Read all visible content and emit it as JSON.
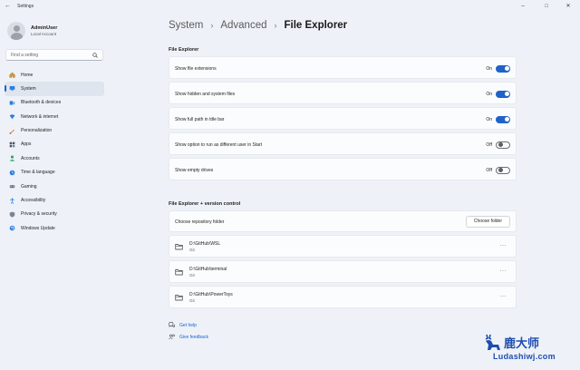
{
  "window": {
    "title": "Settings",
    "back_icon": "back-arrow-icon",
    "controls": {
      "minimize": "–",
      "maximize": "□",
      "close": "✕"
    }
  },
  "profile": {
    "name": "AdminUser",
    "account_type": "Local Account"
  },
  "search": {
    "placeholder": "Find a setting"
  },
  "nav": [
    {
      "label": "Home",
      "icon": "home-icon"
    },
    {
      "label": "System",
      "icon": "system-icon",
      "active": true
    },
    {
      "label": "Bluetooth & devices",
      "icon": "bluetooth-icon"
    },
    {
      "label": "Network & internet",
      "icon": "network-icon"
    },
    {
      "label": "Personalization",
      "icon": "personalization-icon"
    },
    {
      "label": "Apps",
      "icon": "apps-icon"
    },
    {
      "label": "Accounts",
      "icon": "accounts-icon"
    },
    {
      "label": "Time & language",
      "icon": "time-language-icon"
    },
    {
      "label": "Gaming",
      "icon": "gaming-icon"
    },
    {
      "label": "Accessibility",
      "icon": "accessibility-icon"
    },
    {
      "label": "Privacy & security",
      "icon": "privacy-icon"
    },
    {
      "label": "Windows Update",
      "icon": "windows-update-icon"
    }
  ],
  "breadcrumb": {
    "items": [
      "System",
      "Advanced"
    ],
    "current": "File Explorer",
    "separator": "›"
  },
  "file_explorer": {
    "title": "File Explorer",
    "settings": [
      {
        "label": "Show file extensions",
        "state": "On",
        "on": true
      },
      {
        "label": "Show hidden and system files",
        "state": "On",
        "on": true
      },
      {
        "label": "Show full path in title bar",
        "state": "On",
        "on": true
      },
      {
        "label": "Show option to run as different user in Start",
        "state": "Off",
        "on": false
      },
      {
        "label": "Show empty drives",
        "state": "Off",
        "on": false
      }
    ]
  },
  "version_control": {
    "title": "File Explorer + version control",
    "choose_label": "Choose repository folder",
    "choose_button": "Choose folder",
    "repos": [
      {
        "path": "D:\\GitHub\\WSL",
        "type": "Git"
      },
      {
        "path": "D:\\GitHub\\terminal",
        "type": "Git"
      },
      {
        "path": "D:\\GitHub\\PowerToys",
        "type": "Git"
      }
    ],
    "more_label": "···"
  },
  "links": {
    "help": "Get help",
    "feedback": "Give feedback"
  },
  "watermark": {
    "title": "鹿大师",
    "sub": "Ludashiwj.com"
  },
  "colors": {
    "accent": "#1f62c9",
    "background": "#eef2f8",
    "card": "#fbfcfd",
    "link": "#1f5fc4"
  }
}
